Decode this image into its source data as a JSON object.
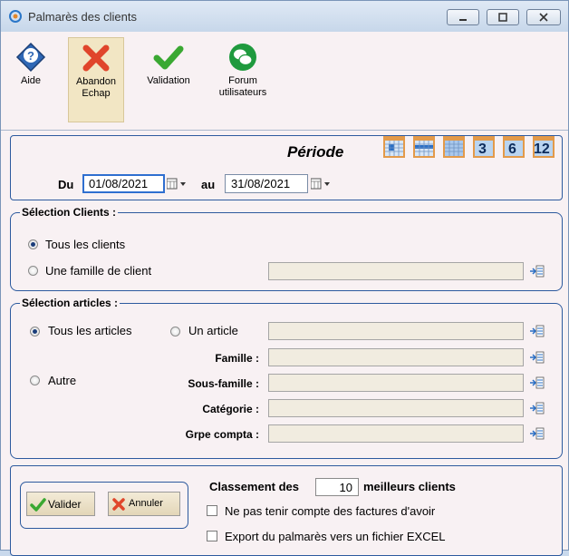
{
  "window": {
    "title": "Palmarès des clients"
  },
  "toolbar": {
    "help_label": "Aide",
    "abandon_label_1": "Abandon",
    "abandon_label_2": "Echap",
    "validate_label": "Validation",
    "forum_label_1": "Forum",
    "forum_label_2": "utilisateurs"
  },
  "period": {
    "title": "Période",
    "from_label": "Du",
    "from_value": "01/08/2021",
    "to_label": "au",
    "to_value": "31/08/2021",
    "presets": [
      "3",
      "6",
      "12"
    ]
  },
  "clients": {
    "legend": "Sélection Clients :",
    "opt_all": "Tous les clients",
    "opt_family": "Une famille de client",
    "selected": "Tous les clients",
    "family_value": ""
  },
  "articles": {
    "legend": "Sélection articles :",
    "opt_all": "Tous les articles",
    "opt_one": "Un article",
    "opt_other": "Autre",
    "selected": "Tous les articles",
    "family_label": "Famille :",
    "subfamily_label": "Sous-famille :",
    "category_label": "Catégorie :",
    "account_label": "Grpe compta :"
  },
  "footer": {
    "validate_button": "Valider",
    "cancel_button": "Annuler",
    "ranking_prefix": "Classement des",
    "ranking_value": "10",
    "ranking_suffix": "meilleurs clients",
    "ignore_credit_notes": "Ne pas tenir compte des factures d'avoir",
    "export_excel": "Export du palmarès vers un fichier EXCEL"
  },
  "colors": {
    "accent": "#2d5a9e",
    "field_bg": "#f1ece0",
    "window_bg": "#f8f1f3",
    "validate_green": "#3aa832",
    "abandon_red": "#e0452b"
  }
}
